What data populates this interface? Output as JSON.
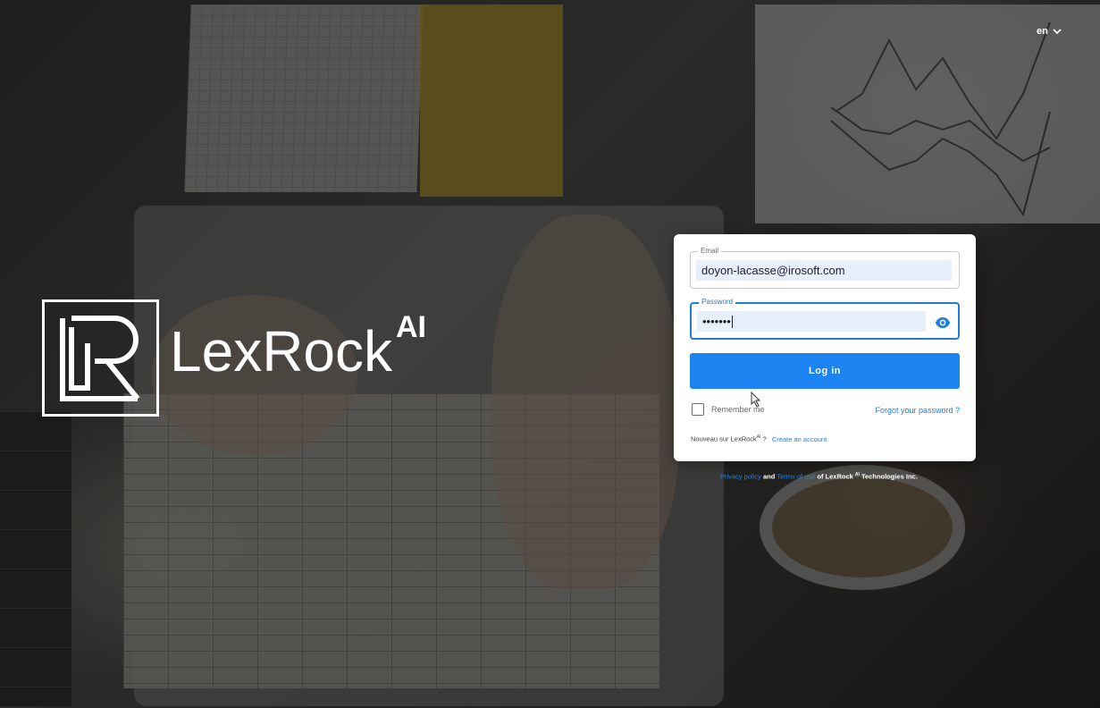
{
  "language_selector": {
    "value": "en",
    "icon": "chevron-down-icon"
  },
  "brand": {
    "name": "LexRock",
    "suffix": "AI",
    "logo_icon": "lr-monogram-logo"
  },
  "login_form": {
    "email": {
      "label": "Email",
      "value": "doyon-lacasse@irosoft.com"
    },
    "password": {
      "label": "Password",
      "value": "•••••••",
      "toggle_icon": "eye-icon"
    },
    "submit_label": "Log in",
    "remember_label": "Remember me",
    "remember_checked": false,
    "forgot_label": "Forgot your password ?",
    "signup_prefix": "Nouveau sur LexRock",
    "signup_prefix_sup": "AI",
    "signup_suffix": " ?",
    "signup_link": "Create an account"
  },
  "footer": {
    "privacy_link": "Privacy policy",
    "and": " and ",
    "terms_link": "Terms of use",
    "of": " of LexRock ",
    "sup": "AI",
    "company": " Technologies Inc."
  },
  "colors": {
    "primary": "#1b84f0",
    "card_bg": "#ffffff"
  }
}
